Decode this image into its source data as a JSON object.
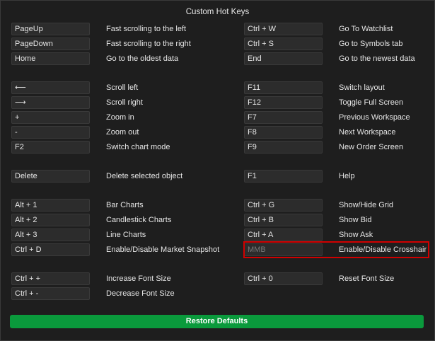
{
  "dialog": {
    "title": "Custom Hot Keys",
    "restore_label": "Restore Defaults",
    "accent_green": "#0a9a3c",
    "highlight_red": "#d00000"
  },
  "left": [
    {
      "key": "PageUp",
      "desc": "Fast scrolling to the left"
    },
    {
      "key": "PageDown",
      "desc": "Fast scrolling to the right"
    },
    {
      "key": "Home",
      "desc": "Go to the oldest data"
    },
    {
      "key": "⟵",
      "desc": "Scroll left"
    },
    {
      "key": "⟶",
      "desc": "Scroll right"
    },
    {
      "key": "+",
      "desc": "Zoom in"
    },
    {
      "key": "-",
      "desc": "Zoom out"
    },
    {
      "key": "F2",
      "desc": "Switch chart mode"
    },
    {
      "key": "Delete",
      "desc": "Delete selected object"
    },
    {
      "key": "Alt + 1",
      "desc": "Bar Charts"
    },
    {
      "key": "Alt + 2",
      "desc": "Candlestick Charts"
    },
    {
      "key": "Alt + 3",
      "desc": "Line Charts"
    },
    {
      "key": "Ctrl + D",
      "desc": "Enable/Disable Market Snapshot"
    },
    {
      "key": "Ctrl + +",
      "desc": "Increase Font Size"
    },
    {
      "key": "Ctrl + -",
      "desc": "Decrease Font Size"
    }
  ],
  "right": [
    {
      "key": "Ctrl + W",
      "desc": "Go To Watchlist"
    },
    {
      "key": "Ctrl + S",
      "desc": "Go to Symbols tab"
    },
    {
      "key": "End",
      "desc": "Go to the newest data"
    },
    {
      "key": "F11",
      "desc": "Switch layout"
    },
    {
      "key": "F12",
      "desc": "Toggle Full Screen"
    },
    {
      "key": "F7",
      "desc": "Previous Workspace"
    },
    {
      "key": "F8",
      "desc": "Next Workspace"
    },
    {
      "key": "F9",
      "desc": "New Order Screen"
    },
    {
      "key": "F1",
      "desc": "Help"
    },
    {
      "key": "Ctrl + G",
      "desc": "Show/Hide Grid"
    },
    {
      "key": "Ctrl + B",
      "desc": "Show Bid"
    },
    {
      "key": "Ctrl + A",
      "desc": "Show Ask"
    },
    {
      "key": "",
      "placeholder": "MMB",
      "desc": "Enable/Disable Crosshair"
    },
    {
      "key": "Ctrl + 0",
      "desc": "Reset Font Size"
    }
  ]
}
